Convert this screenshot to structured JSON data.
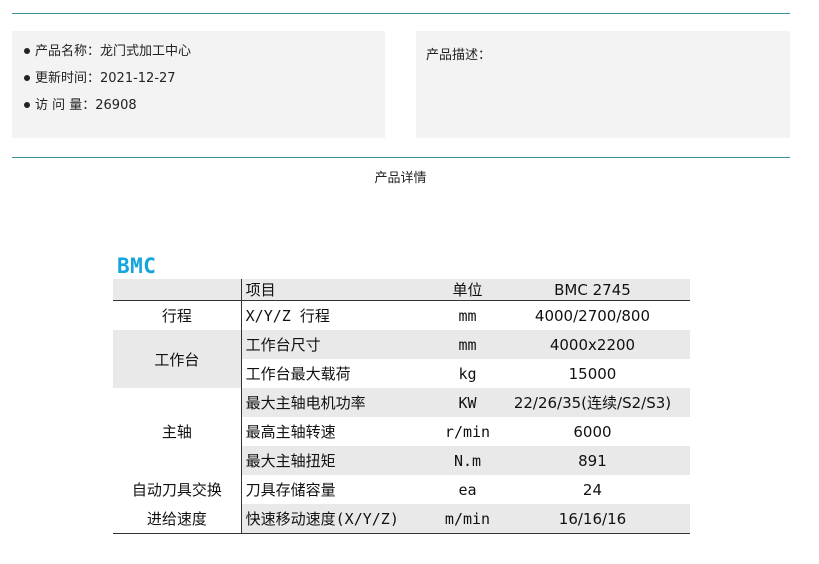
{
  "product_info": {
    "name_label": "产品名称：",
    "name_value": "龙门式加工中心",
    "updated_label": "更新时间：",
    "updated_value": "2021-12-27",
    "views_label": "访 问 量：",
    "views_value": "26908"
  },
  "description": {
    "label": "产品描述："
  },
  "detail_title": "产品详情",
  "spec": {
    "title": "BMC 2745",
    "headers": {
      "category": "",
      "item": "项目",
      "unit": "单位",
      "value": "BMC 2745"
    },
    "rows": [
      {
        "category": "行程",
        "item": "X/Y/Z 行程",
        "unit": "mm",
        "value": "4000/2700/800"
      },
      {
        "category": "工作台",
        "item": "工作台尺寸",
        "unit": "mm",
        "value": "4000x2200"
      },
      {
        "category": "",
        "item": "工作台最大载荷",
        "unit": "kg",
        "value": "15000"
      },
      {
        "category": "主轴",
        "item": "最大主轴电机功率",
        "unit": "KW",
        "value": "22/26/35(连续/S2/S3)"
      },
      {
        "category": "",
        "item": "最高主轴转速",
        "unit": "r/min",
        "value": "6000"
      },
      {
        "category": "",
        "item": "最大主轴扭矩",
        "unit": "N.m",
        "value": "891"
      },
      {
        "category": "自动刀具交换",
        "item": "刀具存储容量",
        "unit": "ea",
        "value": "24"
      },
      {
        "category": "进给速度",
        "item": "快速移动速度(X/Y/Z)",
        "unit": "m/min",
        "value": "16/16/16"
      }
    ]
  },
  "colors": {
    "accent_rule": "#3d8f9c",
    "title_blue": "#15a5dd",
    "panel_bg": "#f3f3f3",
    "row_shade": "#e9e9e9"
  }
}
